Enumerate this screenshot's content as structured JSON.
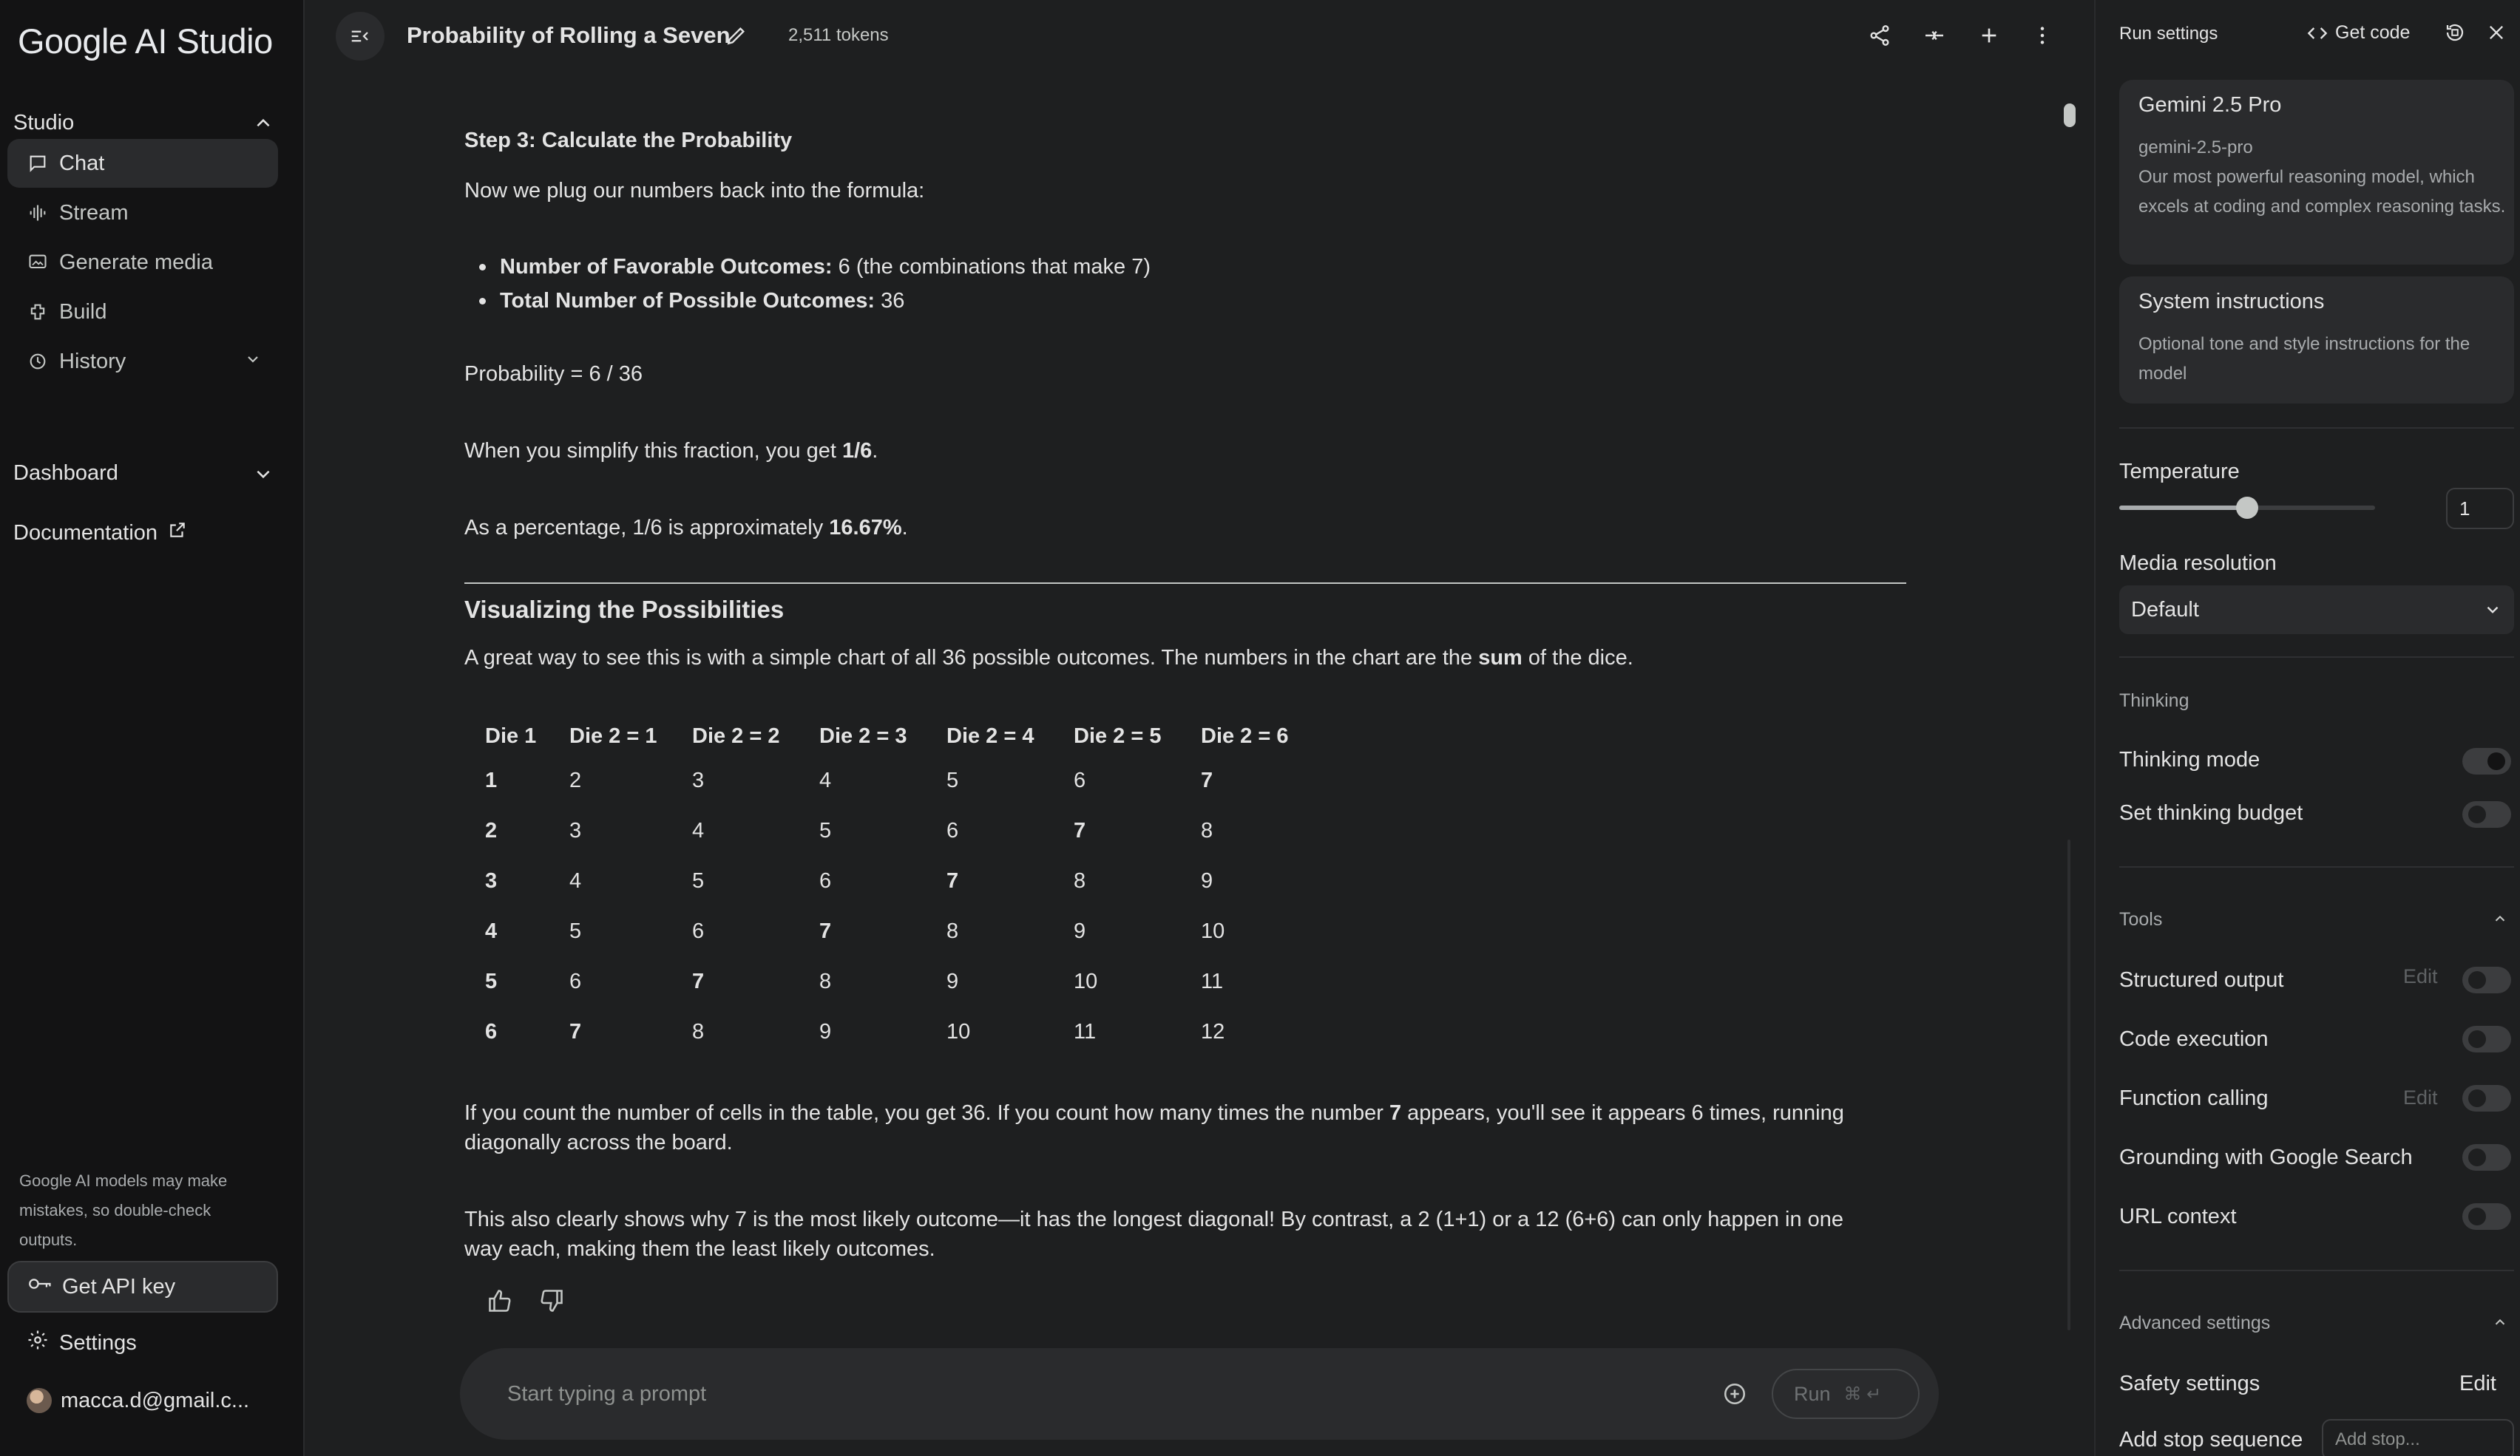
{
  "app": {
    "logo": "Google AI Studio"
  },
  "sidebar": {
    "studio_label": "Studio",
    "items": [
      {
        "label": "Chat",
        "icon": "chat-icon"
      },
      {
        "label": "Stream",
        "icon": "stream-icon"
      },
      {
        "label": "Generate media",
        "icon": "media-icon"
      },
      {
        "label": "Build",
        "icon": "build-icon"
      },
      {
        "label": "History",
        "icon": "history-icon"
      }
    ],
    "dashboard_label": "Dashboard",
    "documentation_label": "Documentation",
    "disclaimer": "Google AI models may make mistakes, so double-check outputs.",
    "api_key_label": "Get API key",
    "settings_label": "Settings",
    "account_label": "macca.d@gmail.c..."
  },
  "topbar": {
    "title": "Probability of Rolling a Seven",
    "tokens": "2,511 tokens"
  },
  "content": {
    "step3_heading": "Step 3: Calculate the Probability",
    "step3_intro": "Now we plug our numbers back into the formula:",
    "bullet1_label": "Number of Favorable Outcomes:",
    "bullet1_value": " 6 (the combinations that make 7)",
    "bullet2_label": "Total Number of Possible Outcomes:",
    "bullet2_value": " 36",
    "probability_line": "Probability = 6 / 36",
    "simplify_text": "When you simplify this fraction, you get ",
    "simplify_value": "1/6",
    "simplify_end": ".",
    "percent_text": "As a percentage, 1/6 is approximately ",
    "percent_value": "16.67%",
    "percent_end": ".",
    "viz_heading": "Visualizing the Possibilities",
    "viz_intro_a": "A great way to see this is with a simple chart of all 36 possible outcomes. The numbers in the chart are the ",
    "viz_intro_bold": "sum",
    "viz_intro_b": " of the dice.",
    "table": {
      "headers": [
        "Die 1",
        "Die 2 = 1",
        "Die 2 = 2",
        "Die 2 = 3",
        "Die 2 = 4",
        "Die 2 = 5",
        "Die 2 = 6"
      ],
      "rows": [
        [
          "1",
          "2",
          "3",
          "4",
          "5",
          "6",
          "7"
        ],
        [
          "2",
          "3",
          "4",
          "5",
          "6",
          "7",
          "8"
        ],
        [
          "3",
          "4",
          "5",
          "6",
          "7",
          "8",
          "9"
        ],
        [
          "4",
          "5",
          "6",
          "7",
          "8",
          "9",
          "10"
        ],
        [
          "5",
          "6",
          "7",
          "8",
          "9",
          "10",
          "11"
        ],
        [
          "6",
          "7",
          "8",
          "9",
          "10",
          "11",
          "12"
        ]
      ]
    },
    "count_a": "If you count the number of cells in the table, you get 36. If you count how many times the number ",
    "count_bold": "7",
    "count_b": " appears, you'll see it appears 6 times, running",
    "count_line2": "diagonally across the board.",
    "contrast_line1": "This also clearly shows why 7 is the most likely outcome—it has the longest diagonal! By contrast, a 2 (1+1) or a 12 (6+6) can only happen in one",
    "contrast_line2": "way each, making them the least likely outcomes."
  },
  "prompt": {
    "placeholder": "Start typing a prompt",
    "run_label": "Run",
    "run_shortcut": "⌘ ↵"
  },
  "run_settings": {
    "title": "Run settings",
    "get_code": "Get code",
    "model": {
      "name": "Gemini 2.5 Pro",
      "id": "gemini-2.5-pro",
      "description": "Our most powerful reasoning model, which excels at coding and complex reasoning tasks."
    },
    "system_instructions": {
      "title": "System instructions",
      "placeholder": "Optional tone and style instructions for the model"
    },
    "temperature": {
      "label": "Temperature",
      "value": "1",
      "fraction": 0.5
    },
    "media_resolution": {
      "label": "Media resolution",
      "value": "Default"
    },
    "thinking": {
      "section": "Thinking",
      "mode_label": "Thinking mode",
      "mode_on": true,
      "budget_label": "Set thinking budget",
      "budget_on": false
    },
    "tools": {
      "section": "Tools",
      "structured_output": "Structured output",
      "code_execution": "Code execution",
      "function_calling": "Function calling",
      "grounding": "Grounding with Google Search",
      "url_context": "URL context",
      "edit_label": "Edit"
    },
    "advanced": {
      "section": "Advanced settings",
      "safety_label": "Safety settings",
      "safety_edit": "Edit",
      "stop_label": "Add stop sequence",
      "stop_placeholder": "Add stop..."
    }
  },
  "colors": {
    "background": "#1e1f20",
    "sidebar": "#131314",
    "accent": "#c4c7c5"
  }
}
